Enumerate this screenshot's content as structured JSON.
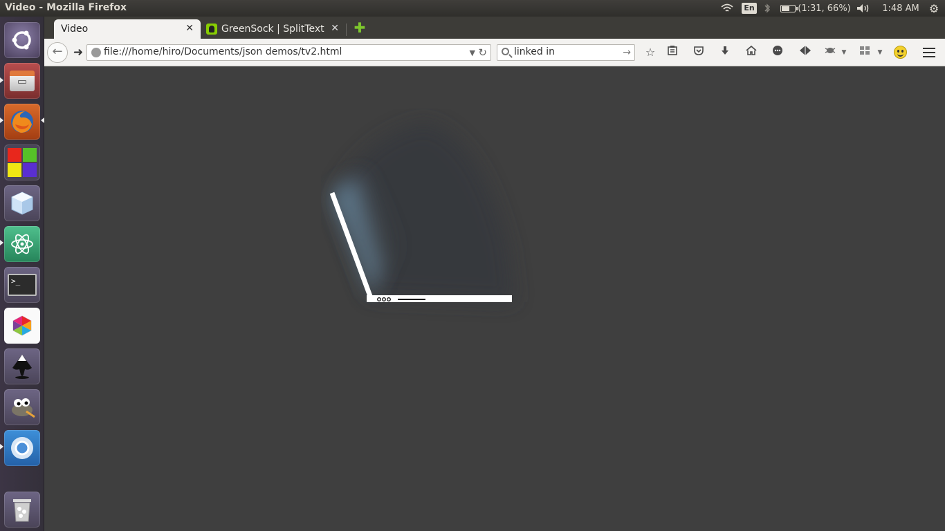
{
  "panel": {
    "window_title": "Video - Mozilla Firefox",
    "keyboard_layout": "En",
    "battery_text": "(1:31, 66%)",
    "battery_level": 0.66,
    "clock": "1:48 AM",
    "icons": [
      "wifi-icon",
      "bluetooth-icon",
      "battery-icon",
      "volume-icon",
      "session-gear-icon"
    ]
  },
  "launcher": {
    "items": [
      "ubuntu-dash",
      "files",
      "firefox",
      "app-grid",
      "virtualbox",
      "atom",
      "terminal",
      "app-cube",
      "inkscape",
      "gimp",
      "chromium",
      "trash"
    ]
  },
  "browser": {
    "tabs": [
      {
        "label": "Video",
        "active": true
      },
      {
        "label": "GreenSock | SplitText",
        "active": false
      }
    ],
    "url": "file:///home/hiro/Documents/json demos/tv2.html",
    "search_value": "linked in"
  },
  "colors": {
    "page_background": "#3f3f3f",
    "screen_glow": "#5b7a90",
    "green_plus": "#7ec82d"
  }
}
